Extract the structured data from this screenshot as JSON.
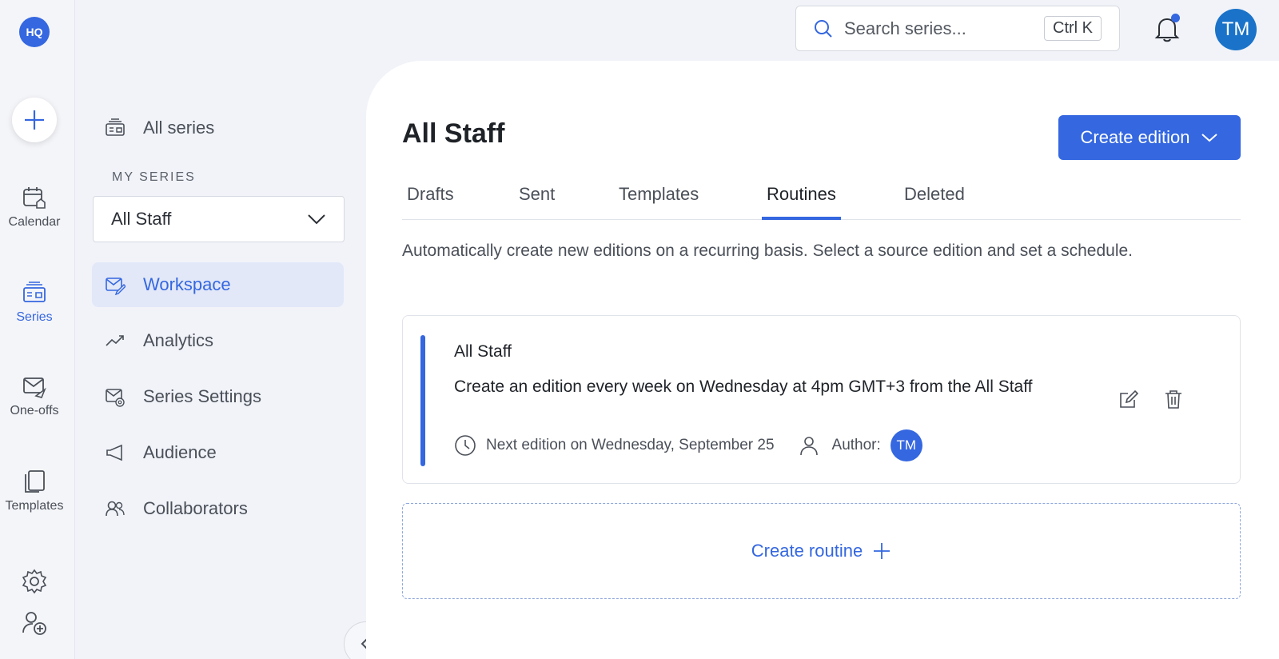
{
  "rail": {
    "logo_text": "HQ",
    "items": [
      {
        "label": "Calendar",
        "icon": "calendar-home-icon"
      },
      {
        "label": "Series",
        "icon": "series-icon",
        "active": true
      },
      {
        "label": "One-offs",
        "icon": "mail-send-icon"
      },
      {
        "label": "Templates",
        "icon": "templates-icon"
      }
    ]
  },
  "sidebar": {
    "all_series": "All series",
    "section_label": "MY SERIES",
    "selected_series": "All Staff",
    "links": [
      {
        "label": "Workspace",
        "icon": "workspace-icon",
        "active": true
      },
      {
        "label": "Analytics",
        "icon": "analytics-icon"
      },
      {
        "label": "Series Settings",
        "icon": "series-settings-icon"
      },
      {
        "label": "Audience",
        "icon": "megaphone-icon"
      },
      {
        "label": "Collaborators",
        "icon": "collaborators-icon"
      }
    ]
  },
  "topbar": {
    "search_placeholder": "Search series...",
    "shortcut": "Ctrl K",
    "user_initials": "TM"
  },
  "main": {
    "title": "All Staff",
    "create_edition_label": "Create edition",
    "tabs": [
      {
        "label": "Drafts"
      },
      {
        "label": "Sent"
      },
      {
        "label": "Templates"
      },
      {
        "label": "Routines",
        "active": true
      },
      {
        "label": "Deleted"
      }
    ],
    "description": "Automatically create new editions on a recurring basis. Select a source edition and set a schedule.",
    "routine": {
      "name": "All Staff",
      "description": "Create an edition every week on Wednesday at 4pm GMT+3 from the All Staff",
      "next_edition": "Next edition on Wednesday, September 25",
      "author_label": "Author:",
      "author_initials": "TM"
    },
    "create_routine_label": "Create routine"
  },
  "colors": {
    "accent": "#3467e0",
    "avatar_top": "#1a73c9",
    "background": "#f1f3f9"
  }
}
